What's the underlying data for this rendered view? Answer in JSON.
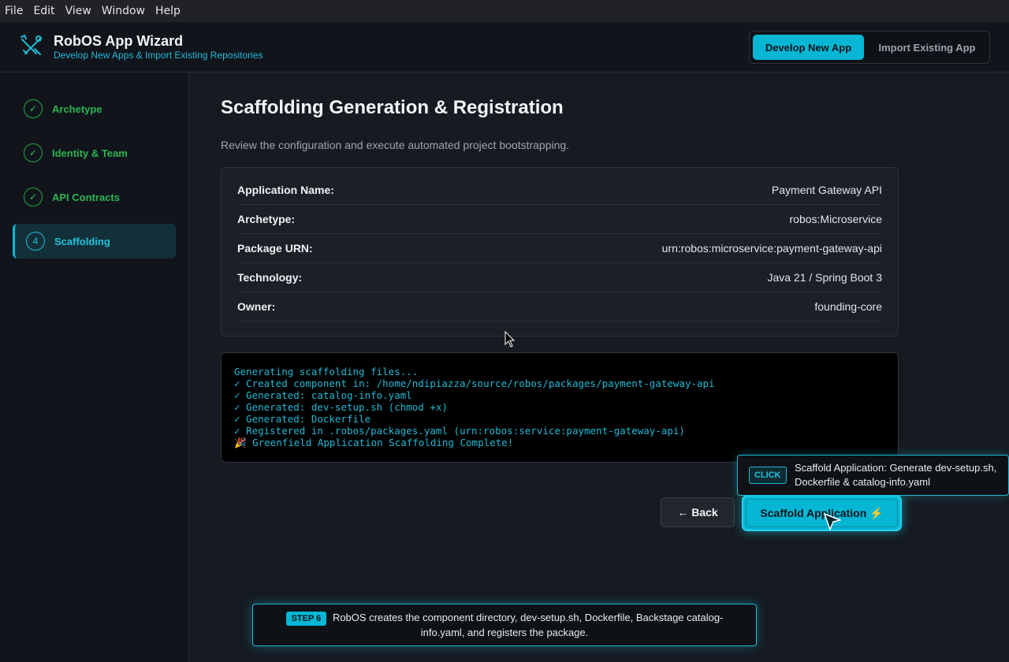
{
  "menu": [
    "File",
    "Edit",
    "View",
    "Window",
    "Help"
  ],
  "header": {
    "title": "RobOS App Wizard",
    "subtitle": "Develop New Apps & Import Existing Repositories",
    "develop_label": "Develop New App",
    "import_label": "Import Existing App",
    "logo_icon": "tools-icon"
  },
  "sidebar": {
    "steps": [
      {
        "marker": "✓",
        "label": "Archetype",
        "state": "complete"
      },
      {
        "marker": "✓",
        "label": "Identity & Team",
        "state": "complete"
      },
      {
        "marker": "✓",
        "label": "API Contracts",
        "state": "complete"
      },
      {
        "marker": "4",
        "label": "Scaffolding",
        "state": "active"
      }
    ]
  },
  "main": {
    "title": "Scaffolding Generation & Registration",
    "description": "Review the configuration and execute automated project bootstrapping.",
    "summary": [
      {
        "key": "Application Name:",
        "value": "Payment Gateway API"
      },
      {
        "key": "Archetype:",
        "value": "robos:Microservice"
      },
      {
        "key": "Package URN:",
        "value": "urn:robos:microservice:payment-gateway-api"
      },
      {
        "key": "Technology:",
        "value": "Java 21 / Spring Boot 3"
      },
      {
        "key": "Owner:",
        "value": "founding-core"
      }
    ],
    "terminal_lines": [
      "Generating scaffolding files...",
      "✓ Created component in: /home/ndipiazza/source/robos/packages/payment-gateway-api",
      "✓ Generated: catalog-info.yaml",
      "✓ Generated: dev-setup.sh (chmod +x)",
      "✓ Generated: Dockerfile",
      "✓ Registered in .robos/packages.yaml (urn:robos:service:payment-gateway-api)",
      "🎉 Greenfield Application Scaffolding Complete!"
    ],
    "back_label": "← Back",
    "scaffold_label": "Scaffold Application ⚡"
  },
  "tooltip": {
    "badge": "CLICK",
    "text": "Scaffold Application: Generate dev-setup.sh, Dockerfile & catalog-info.yaml"
  },
  "caption": {
    "badge": "STEP 6",
    "text": "RobOS creates the component directory, dev-setup.sh, Dockerfile, Backstage catalog-info.yaml, and registers the package."
  },
  "colors": {
    "accent": "#06b6d4",
    "success": "#2bb552",
    "background": "#161a21"
  }
}
